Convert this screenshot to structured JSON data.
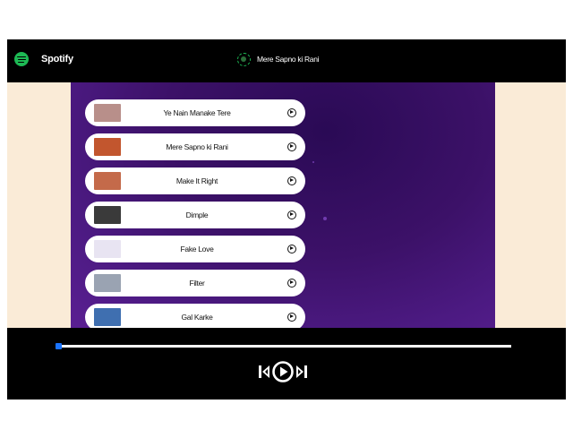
{
  "navbar": {
    "brand_name": "Spotify",
    "brand_icon": "spotify-logo-icon",
    "now_playing_icon": "playing-gif-icon",
    "now_playing_title": "Mere Sapno ki Rani"
  },
  "songs": [
    {
      "name": "Ye Nain Manake Tere",
      "cover_color": "#b88f8a"
    },
    {
      "name": "Mere Sapno ki Rani",
      "cover_color": "#c2562e"
    },
    {
      "name": "Make It Right",
      "cover_color": "#c46a4a"
    },
    {
      "name": "Dimple",
      "cover_color": "#3a3a3a"
    },
    {
      "name": "Fake Love",
      "cover_color": "#e8e4f2"
    },
    {
      "name": "Filter",
      "cover_color": "#9aa3b2"
    },
    {
      "name": "Gal Karke",
      "cover_color": "#3f6fb0"
    }
  ],
  "player": {
    "progress": 0,
    "accent_color": "#1a73ff",
    "previous_icon": "skip-previous-icon",
    "play_icon": "play-circle-icon",
    "next_icon": "skip-next-icon"
  },
  "colors": {
    "brand_green": "#1db954",
    "side_background": "#faebd7",
    "list_background": "#3c1168"
  }
}
